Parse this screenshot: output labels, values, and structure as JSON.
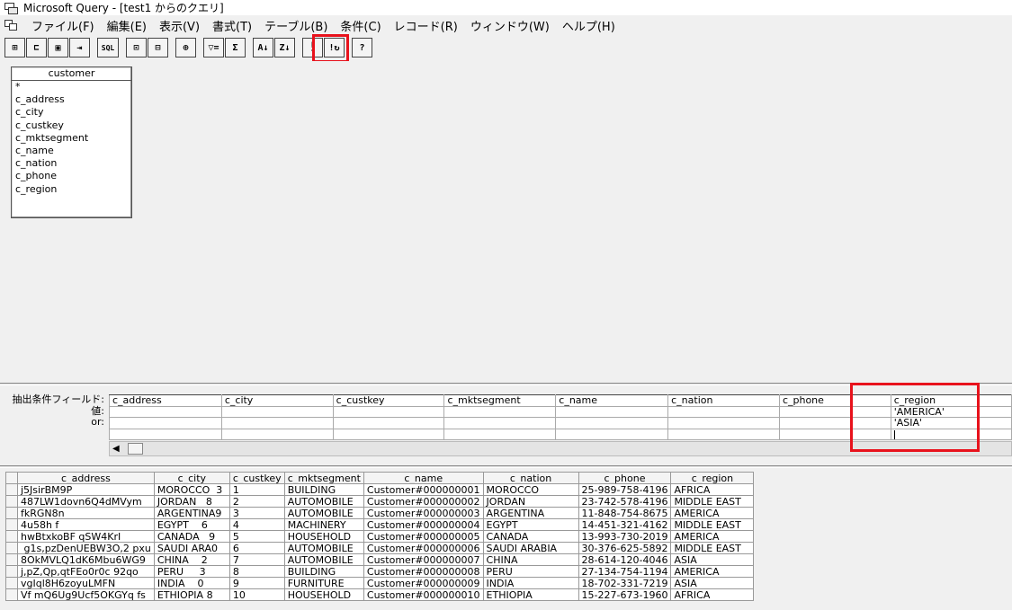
{
  "window": {
    "title": "Microsoft Query - [test1 からのクエリ]"
  },
  "menu": [
    "ファイル(F)",
    "編集(E)",
    "表示(V)",
    "書式(T)",
    "テーブル(B)",
    "条件(C)",
    "レコード(R)",
    "ウィンドウ(W)",
    "ヘルプ(H)"
  ],
  "toolbar": {
    "sql_label": "SQL",
    "run_label": "!",
    "buttons": [
      {
        "name": "new-query-icon",
        "glyph": "⊞"
      },
      {
        "name": "open-query-icon",
        "glyph": "📂"
      },
      {
        "name": "save-query-icon",
        "glyph": "💾"
      },
      {
        "name": "return-data-icon",
        "glyph": "⇥"
      },
      {
        "name": "sql-view-icon",
        "glyph": "SQL"
      },
      {
        "name": "show-tables-icon",
        "glyph": "⊡"
      },
      {
        "name": "show-criteria-icon",
        "glyph": "⊟"
      },
      {
        "name": "add-tables-icon",
        "glyph": "⊕"
      },
      {
        "name": "criteria-equals-icon",
        "glyph": "▽="
      },
      {
        "name": "totals-icon",
        "glyph": "Σ"
      },
      {
        "name": "sort-ascending-icon",
        "glyph": "A↓"
      },
      {
        "name": "sort-descending-icon",
        "glyph": "Z↓"
      },
      {
        "name": "query-now-icon",
        "glyph": "!"
      },
      {
        "name": "auto-query-icon",
        "glyph": "!↻"
      },
      {
        "name": "help-icon",
        "glyph": "?"
      }
    ]
  },
  "table_box": {
    "title": "customer",
    "fields": [
      "*",
      "c_address",
      "c_city",
      "c_custkey",
      "c_mktsegment",
      "c_name",
      "c_nation",
      "c_phone",
      "c_region"
    ]
  },
  "criteria": {
    "row_labels": [
      "抽出条件フィールド:",
      "値:",
      "or:"
    ],
    "fields": [
      "c_address",
      "c_city",
      "c_custkey",
      "c_mktsegment",
      "c_name",
      "c_nation",
      "c_phone",
      "c_region"
    ],
    "values": [
      "",
      "",
      "",
      "",
      "",
      "",
      "",
      "'AMERICA'"
    ],
    "or": [
      "",
      "",
      "",
      "",
      "",
      "",
      "",
      "'ASIA'"
    ],
    "extra": [
      "",
      "",
      "",
      "",
      "",
      "",
      "",
      ""
    ],
    "scroll_left": "◀"
  },
  "results": {
    "columns": [
      "c_address",
      "c_city",
      "c_custkey",
      "c_mktsegment",
      "c_name",
      "c_nation",
      "c_phone",
      "c_region"
    ],
    "rows": [
      [
        "j5JsirBM9P",
        "MOROCCO  3",
        "1",
        "BUILDING",
        "Customer#000000001",
        "MOROCCO",
        "25-989-758-4196",
        "AFRICA"
      ],
      [
        "487LW1dovn6Q4dMVym",
        "JORDAN   8",
        "2",
        "AUTOMOBILE",
        "Customer#000000002",
        "JORDAN",
        "23-742-578-4196",
        "MIDDLE EAST"
      ],
      [
        "fkRGN8n",
        "ARGENTINA9",
        "3",
        "AUTOMOBILE",
        "Customer#000000003",
        "ARGENTINA",
        "11-848-754-8675",
        "AMERICA"
      ],
      [
        "4u58h f",
        "EGYPT    6",
        "4",
        "MACHINERY",
        "Customer#000000004",
        "EGYPT",
        "14-451-321-4162",
        "MIDDLE EAST"
      ],
      [
        "hwBtxkoBF qSW4KrI",
        "CANADA   9",
        "5",
        "HOUSEHOLD",
        "Customer#000000005",
        "CANADA",
        "13-993-730-2019",
        "AMERICA"
      ],
      [
        " g1s,pzDenUEBW3O,2 pxu",
        "SAUDI ARA0",
        "6",
        "AUTOMOBILE",
        "Customer#000000006",
        "SAUDI ARABIA",
        "30-376-625-5892",
        "MIDDLE EAST"
      ],
      [
        "8OkMVLQ1dK6Mbu6WG9",
        "CHINA    2",
        "7",
        "AUTOMOBILE",
        "Customer#000000007",
        "CHINA",
        "28-614-120-4046",
        "ASIA"
      ],
      [
        "j,pZ,Qp,qtFEo0r0c 92qo",
        "PERU     3",
        "8",
        "BUILDING",
        "Customer#000000008",
        "PERU",
        "27-134-754-1194",
        "AMERICA"
      ],
      [
        "vgIql8H6zoyuLMFN",
        "INDIA    0",
        "9",
        "FURNITURE",
        "Customer#000000009",
        "INDIA",
        "18-702-331-7219",
        "ASIA"
      ],
      [
        "Vf mQ6Ug9Ucf5OKGYq fs",
        "ETHIOPIA 8",
        "10",
        "HOUSEHOLD",
        "Customer#000000010",
        "ETHIOPIA",
        "15-227-673-1960",
        "AFRICA"
      ]
    ]
  },
  "colors": {
    "highlight": "#e8121c"
  }
}
